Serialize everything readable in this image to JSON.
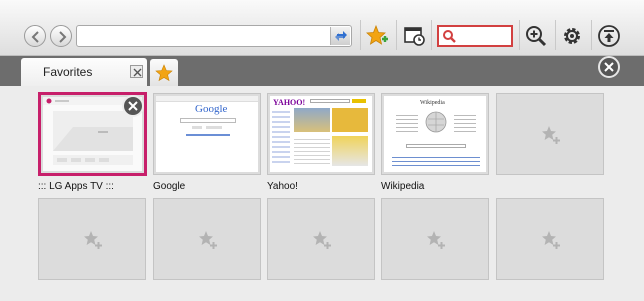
{
  "toolbar": {
    "back_icon": "back-arrow-icon",
    "forward_icon": "forward-arrow-icon",
    "url_value": "",
    "refresh_icon": "refresh-icon",
    "add_favorite_icon": "star-add-icon",
    "tabs_icon": "window-clock-icon",
    "search_value": "",
    "search_icon": "search-icon",
    "zoom_icon": "zoom-in-icon",
    "settings_icon": "gear-icon",
    "scroll_top_icon": "arrow-up-top-icon"
  },
  "tabs": [
    {
      "label": "Favorites",
      "active": true
    }
  ],
  "favorites": [
    {
      "label": "::: LG Apps TV :::",
      "thumb": "lg-apps",
      "selected": true
    },
    {
      "label": "Google",
      "thumb": "google"
    },
    {
      "label": "Yahoo!",
      "thumb": "yahoo"
    },
    {
      "label": "Wikipedia",
      "thumb": "wikipedia"
    },
    {
      "label": "",
      "thumb": "empty"
    },
    {
      "label": "",
      "thumb": "empty"
    },
    {
      "label": "",
      "thumb": "empty"
    },
    {
      "label": "",
      "thumb": "empty"
    },
    {
      "label": "",
      "thumb": "empty"
    },
    {
      "label": "",
      "thumb": "empty"
    }
  ],
  "thumb_text": {
    "google_logo": "Google",
    "yahoo_logo": "YAHOO!",
    "wikipedia_title": "Wikipedia"
  },
  "colors": {
    "accent_pink": "#c71f6a",
    "search_border": "#d24040",
    "star": "#f2a413"
  }
}
